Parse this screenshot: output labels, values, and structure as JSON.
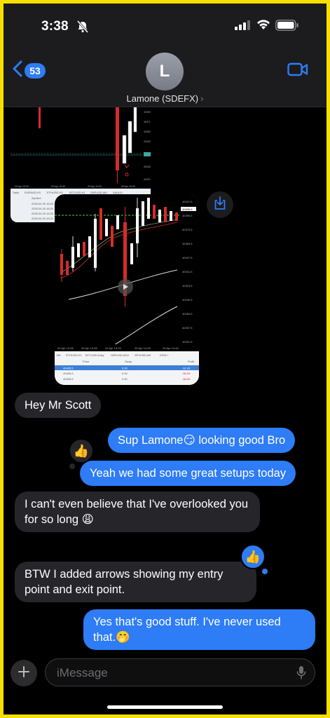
{
  "status_bar": {
    "time": "3:38"
  },
  "header": {
    "back_badge": "53",
    "avatar_initial": "L",
    "contact_name": "Lamone (SDEFX)",
    "contact_chevron": "›",
    "icons": [
      "chevron-left-icon",
      "video-camera-icon"
    ]
  },
  "attachments": {
    "chart1": {
      "tabs": [
        "Daily",
        "EURAUD,H1",
        "ETHUSD,H1",
        "BTCUSD,H1",
        "GBPUSD,M5",
        "XAUUS"
      ],
      "timeline": [
        "29 Apr 13:00",
        "29 Apr 13:40",
        "29 Apr 14:20",
        "29 Apr 15:00"
      ],
      "rows": [
        "2025.04.29 16:20",
        "2025.04.29 16:20",
        "2025.04.29 16:22",
        "2025.04.29 16:21"
      ],
      "header_label": "Symbol"
    },
    "chart2": {
      "price_axis": [
        "40421.5",
        "40395.5",
        "40379.5",
        "40363.5",
        "40347.5",
        "40331.5",
        "40315.5",
        "40299.5",
        "40283.5",
        "40267.5",
        "40251.5"
      ],
      "current_price": "40406.5",
      "time_axis": [
        "29 Apr 12:05",
        "29 Apr 13:45",
        "29 Apr 13:25",
        "29 Apr 14:05",
        "29 Apr 14:45"
      ],
      "tabs": [
        "M5",
        "ETHUSD,H1",
        "BTCUSD,Daily",
        "GBPUSD,M15",
        "SPXUSD,M5",
        "ES00,*"
      ],
      "table_headers": {
        "price": "Price",
        "swap": "Swap",
        "profit": "Profit"
      },
      "table_rows": [
        {
          "price": "40406.5",
          "swap": "0.00",
          "profit": "-61.00"
        },
        {
          "price": "40406.5",
          "swap": "0.00",
          "profit": "-56.00"
        },
        {
          "price": "40406.5",
          "swap": "0.00",
          "profit": "-58.00"
        }
      ],
      "play_icon": "play-icon"
    },
    "download_icon": "download-icon"
  },
  "messages": [
    {
      "side": "in",
      "text": "Hey Mr Scott"
    },
    {
      "side": "out",
      "text": "Sup Lamone😏 looking good Bro"
    },
    {
      "side": "out",
      "text": "Yeah we had some great setups today"
    },
    {
      "side": "in",
      "text": "I can't even believe that I've overlooked you for so long 😩"
    },
    {
      "side": "in",
      "text": "BTW I added arrows showing my entry point and exit point."
    },
    {
      "side": "out",
      "text": "Yes that's good stuff. I've never used that.🤭"
    }
  ],
  "tapbacks": [
    {
      "icon": "thumbs-up-icon",
      "glyph": "👍"
    },
    {
      "icon": "thumbs-up-icon",
      "glyph": "👍"
    }
  ],
  "composer": {
    "placeholder": "iMessage",
    "icons": [
      "plus-icon",
      "microphone-icon"
    ]
  },
  "colors": {
    "frame": "#f7e000",
    "outgoing_bubble": "#2e7cf6",
    "incoming_bubble": "#26252a",
    "background": "#000000"
  }
}
